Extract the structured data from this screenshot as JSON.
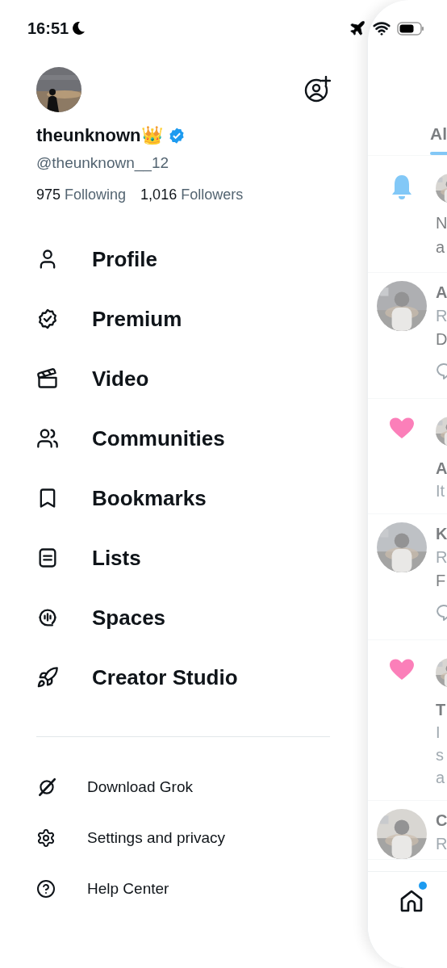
{
  "status_bar": {
    "time": "16:51"
  },
  "profile": {
    "name": "theunknown👑",
    "verified": true,
    "handle": "@theunknown__12",
    "following_count": "975",
    "following_label": "Following",
    "followers_count": "1,016",
    "followers_label": "Followers"
  },
  "menu": [
    {
      "label": "Profile"
    },
    {
      "label": "Premium"
    },
    {
      "label": "Video"
    },
    {
      "label": "Communities"
    },
    {
      "label": "Bookmarks"
    },
    {
      "label": "Lists"
    },
    {
      "label": "Spaces"
    },
    {
      "label": "Creator Studio"
    }
  ],
  "secondary_menu": [
    {
      "label": "Download Grok"
    },
    {
      "label": "Settings and privacy"
    },
    {
      "label": "Help Center"
    }
  ],
  "panel": {
    "tab": {
      "label": "Al",
      "selected": true
    },
    "rows": [
      {
        "kind": "notification",
        "lines": [
          {
            "kind": "body",
            "text": "N"
          },
          {
            "kind": "body",
            "text": "a"
          }
        ]
      },
      {
        "kind": "reply",
        "actions": true,
        "lines": [
          {
            "kind": "name",
            "text": "A"
          },
          {
            "kind": "meta",
            "text": "R"
          },
          {
            "kind": "body",
            "text": "D"
          }
        ]
      },
      {
        "kind": "like",
        "lines": [
          {
            "kind": "name",
            "text": "A"
          },
          {
            "kind": "meta",
            "text": "It"
          }
        ]
      },
      {
        "kind": "reply",
        "actions": true,
        "lines": [
          {
            "kind": "name",
            "text": "K"
          },
          {
            "kind": "meta",
            "text": "R"
          },
          {
            "kind": "body",
            "text": "F"
          }
        ]
      },
      {
        "kind": "like",
        "lines": [
          {
            "kind": "name",
            "text": "T"
          },
          {
            "kind": "meta",
            "text": "I"
          },
          {
            "kind": "meta",
            "text": "s"
          },
          {
            "kind": "meta",
            "text": "a"
          }
        ]
      },
      {
        "kind": "reply",
        "actions": false,
        "lines": [
          {
            "kind": "name",
            "text": "C"
          },
          {
            "kind": "meta",
            "text": "R"
          }
        ]
      }
    ],
    "nav": {
      "home_unread": true
    }
  }
}
